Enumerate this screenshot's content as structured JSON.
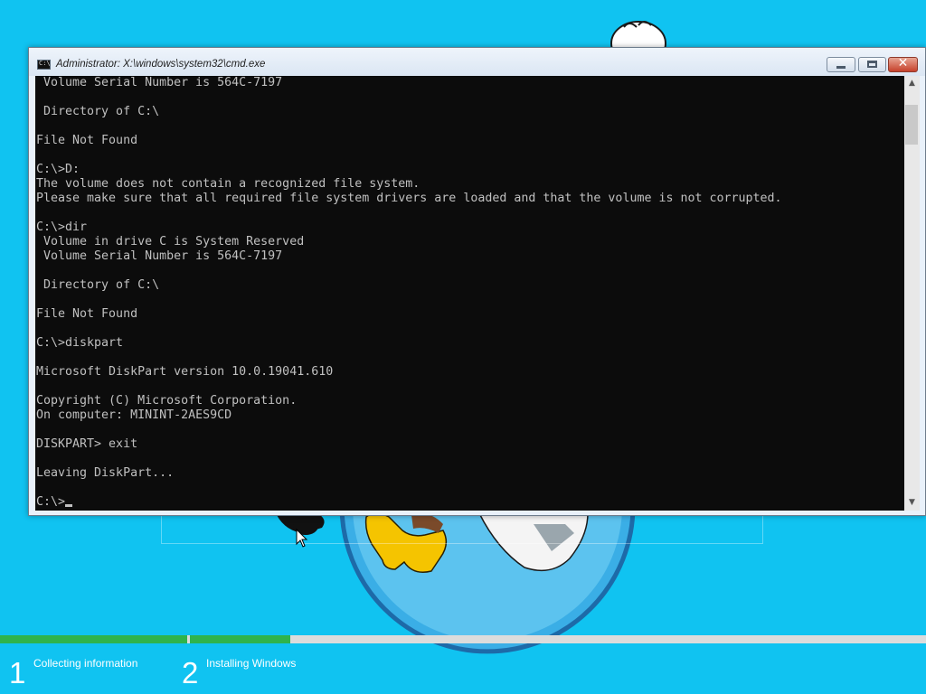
{
  "window": {
    "title": "Administrator: X:\\windows\\system32\\cmd.exe",
    "icon": "cmd-icon"
  },
  "console": {
    "lines": [
      " Volume Serial Number is 564C-7197",
      "",
      " Directory of C:\\",
      "",
      "File Not Found",
      "",
      "C:\\>D:",
      "The volume does not contain a recognized file system.",
      "Please make sure that all required file system drivers are loaded and that the volume is not corrupted.",
      "",
      "C:\\>dir",
      " Volume in drive C is System Reserved",
      " Volume Serial Number is 564C-7197",
      "",
      " Directory of C:\\",
      "",
      "File Not Found",
      "",
      "C:\\>diskpart",
      "",
      "Microsoft DiskPart version 10.0.19041.610",
      "",
      "Copyright (C) Microsoft Corporation.",
      "On computer: MININT-2AES9CD",
      "",
      "DISKPART> exit",
      "",
      "Leaving DiskPart...",
      "",
      "C:\\>"
    ]
  },
  "setup": {
    "steps": [
      {
        "number": "1",
        "label": "Collecting information",
        "progress": 1.0
      },
      {
        "number": "2",
        "label": "Installing Windows",
        "progress": 0.136
      }
    ]
  },
  "colors": {
    "desktop": "#10c3f1",
    "console_bg": "#0c0c0c",
    "console_text": "#c0c0c0",
    "progress_fill": "#2fb34c",
    "progress_track": "#dcdcdc"
  }
}
